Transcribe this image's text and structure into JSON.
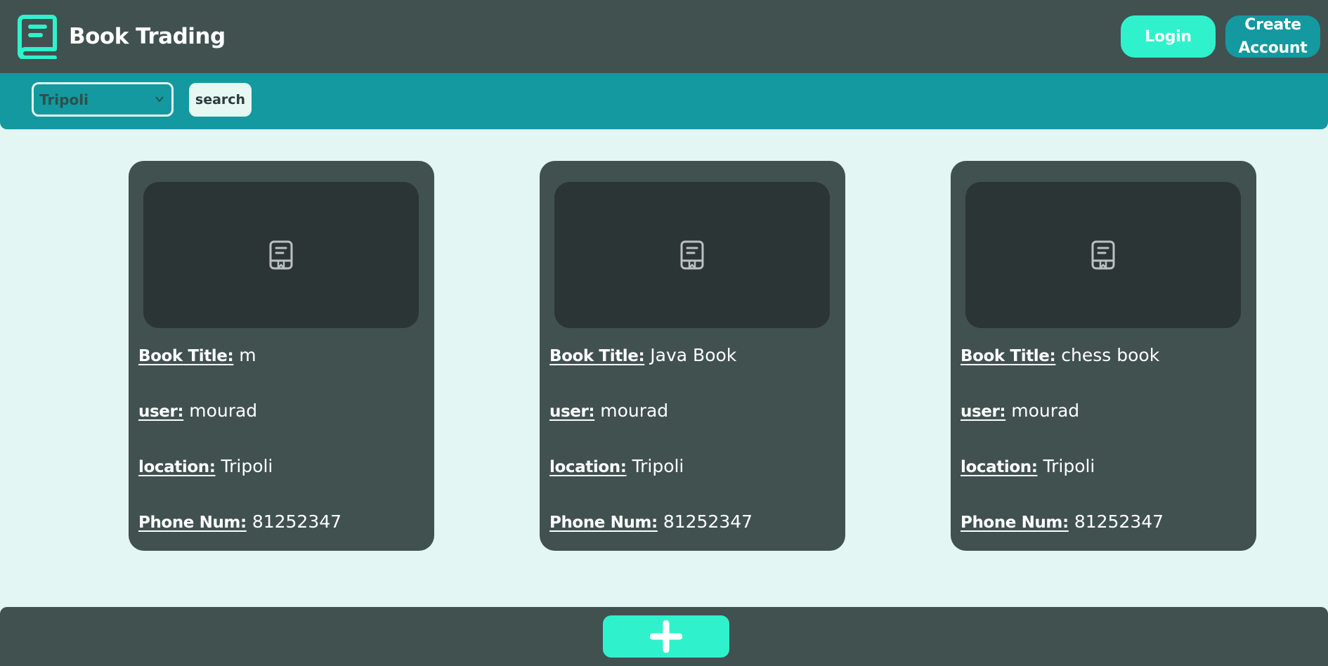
{
  "app": {
    "brand_name": "Book Trading",
    "logo_icon": "book-icon"
  },
  "header": {
    "login_label": "Login",
    "create_account_label": "Create Account"
  },
  "filter": {
    "selected_location": "Tripoli",
    "search_label": "search"
  },
  "labels": {
    "title": "Book Title:",
    "user": "user:",
    "location": "location:",
    "phone": "Phone Num:"
  },
  "books": [
    {
      "title": "m",
      "user": "mourad",
      "location": "Tripoli",
      "phone": "81252347"
    },
    {
      "title": "Java Book",
      "user": "mourad",
      "location": "Tripoli",
      "phone": "81252347"
    },
    {
      "title": "chess book",
      "user": "mourad",
      "location": "Tripoli",
      "phone": "81252347"
    }
  ],
  "footer": {
    "add_icon": "plus-icon"
  },
  "colors": {
    "header_bg": "#415150",
    "accent": "#2ff2cc",
    "teal": "#13999f",
    "page_bg": "#e3f6f3",
    "card_bg": "#415150",
    "image_bg": "#2c3535"
  }
}
